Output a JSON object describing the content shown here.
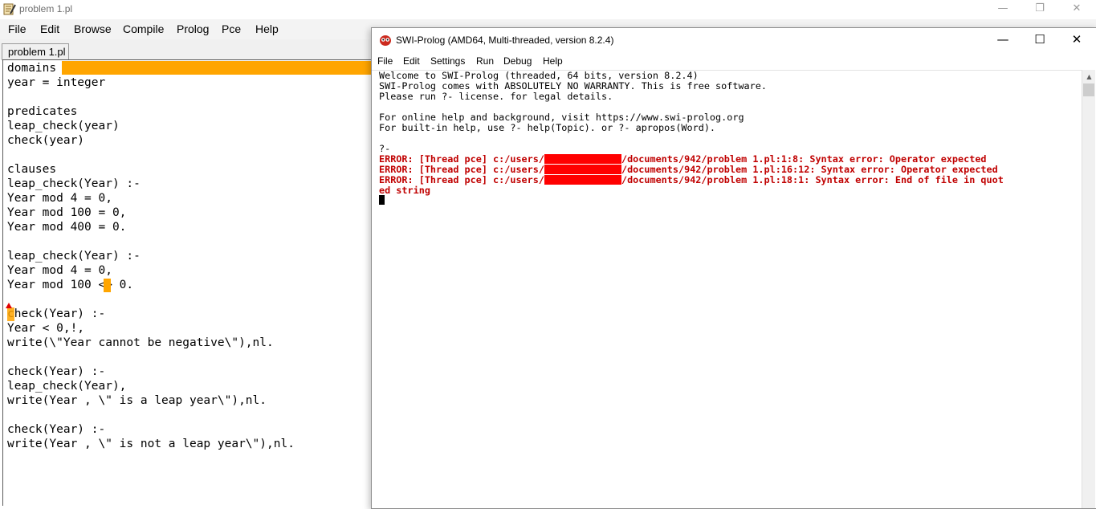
{
  "editor": {
    "window_title": "problem 1.pl",
    "menu": [
      "File",
      "Edit",
      "Browse",
      "Compile",
      "Prolog",
      "Pce",
      "Help"
    ],
    "tab_label": "problem 1.pl",
    "code_lines": [
      "domains",
      "year = integer",
      "",
      "predicates",
      "leap_check(year)",
      "check(year)",
      "",
      "clauses",
      "leap_check(Year) :-",
      "Year mod 4 = 0,",
      "Year mod 100 = 0,",
      "Year mod 400 = 0.",
      "",
      "leap_check(Year) :-",
      "Year mod 4 = 0,",
      "Year mod 100 <> 0.",
      "",
      "check(Year) :-",
      "Year < 0,!,",
      "write(\\\"Year cannot be negative\\\"),nl.",
      "",
      "check(Year) :-",
      "leap_check(Year),",
      "write(Year , \\\" is a leap year\\\"),nl.",
      "",
      "check(Year) :-",
      "write(Year , \\\" is not a leap year\\\"),nl."
    ],
    "highlight_color": "#ffa500"
  },
  "window_controls": {
    "minimize": "—",
    "maximize": "☐",
    "restore": "❐",
    "close": "✕"
  },
  "prolog": {
    "window_title": "SWI-Prolog (AMD64, Multi-threaded, version 8.2.4)",
    "menu": [
      "File",
      "Edit",
      "Settings",
      "Run",
      "Debug",
      "Help"
    ],
    "banner": [
      "Welcome to SWI-Prolog (threaded, 64 bits, version 8.2.4)",
      "SWI-Prolog comes with ABSOLUTELY NO WARRANTY. This is free software.",
      "Please run ?- license. for legal details.",
      "",
      "For online help and background, visit https://www.swi-prolog.org",
      "For built-in help, use ?- help(Topic). or ?- apropos(Word)."
    ],
    "prompt": "?-",
    "errors": [
      {
        "prefix": "ERROR: [Thread pce] c:/users/",
        "suffix": "/documents/942/problem 1.pl:1:8: Syntax error: Operator expected"
      },
      {
        "prefix": "ERROR: [Thread pce] c:/users/",
        "suffix": "/documents/942/problem 1.pl:16:12: Syntax error: Operator expected"
      },
      {
        "prefix": "ERROR: [Thread pce] c:/users/",
        "suffix": "/documents/942/problem 1.pl:18:1: Syntax error: End of file in quot"
      }
    ],
    "error_continuation": "ed string",
    "error_color": "#c00000",
    "redaction_color": "#ff0000"
  }
}
